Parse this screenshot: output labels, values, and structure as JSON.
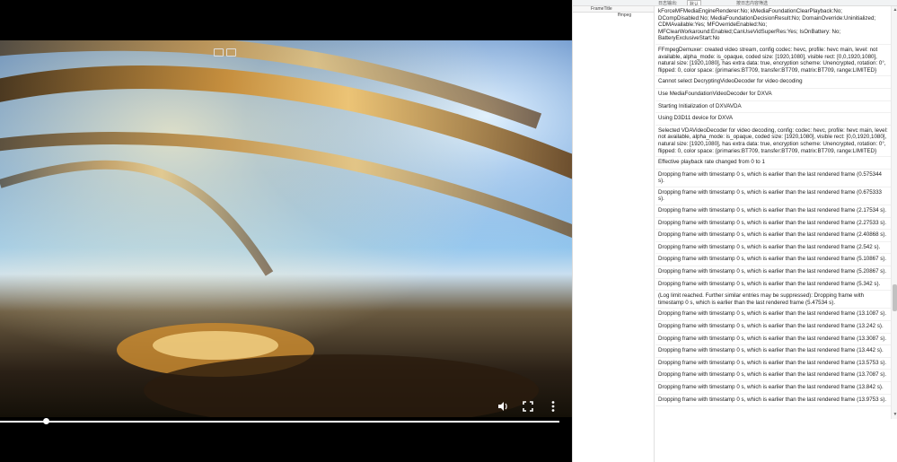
{
  "devtools": {
    "top_left_label": "日志输出:",
    "level_select": "默认",
    "filter_placeholder": "按日志内容筛选",
    "column_header": "FrameTitle",
    "column_header_2": "ffmpeg"
  },
  "log": [
    "kForceMFMediaEngineRenderer:No; kMediaFoundationClearPlayback:No; DCompDisabled:No; MediaFoundationDecisionResult:No; DomainOverride:Uninitialized; CDMAvailable:Yes; MFOverrideEnabled:No; MFClearWorkaround:Enabled;CanUseVidSuperRes:Yes; IsOnBattery: No; BatteryExclusiveStart:No",
    "FFmpegDemuxer: created video stream, config codec: hevc, profile: hevc main, level: not available, alpha_mode: is_opaque, coded size: [1920,1080], visible rect: [0,0,1920,1080], natural size: [1920,1080], has extra data: true, encryption scheme: Unencrypted, rotation: 0°, flipped: 0, color space: {primaries:BT709, transfer:BT709, matrix:BT709, range:LIMITED}",
    "Cannot select DecryptingVideoDecoder for video decoding",
    "Use MediaFoundationVideoDecoder for DXVA",
    "Starting Initialization of DXVAVDA",
    "Using D3D11 device for DXVA",
    "Selected VDAVideoDecoder for video decoding, config: codec: hevc, profile: hevc main, level: not available, alpha_mode: is_opaque, coded size: [1920,1080], visible rect: [0,0,1920,1080], natural size: [1920,1080], has extra data: true, encryption scheme: Unencrypted, rotation: 0°, flipped: 0, color space: {primaries:BT709, transfer:BT709, matrix:BT709, range:LIMITED}",
    "Effective playback rate changed from 0 to 1",
    "Dropping frame with timestamp 0 s, which is earlier than the last rendered frame (0.575344 s).",
    "Dropping frame with timestamp 0 s, which is earlier than the last rendered frame (0.675333 s).",
    "Dropping frame with timestamp 0 s, which is earlier than the last rendered frame (2.17534 s).",
    "Dropping frame with timestamp 0 s, which is earlier than the last rendered frame (2.27533 s).",
    "Dropping frame with timestamp 0 s, which is earlier than the last rendered frame (2.40868 s).",
    "Dropping frame with timestamp 0 s, which is earlier than the last rendered frame (2.542 s).",
    "Dropping frame with timestamp 0 s, which is earlier than the last rendered frame (5.10867 s).",
    "Dropping frame with timestamp 0 s, which is earlier than the last rendered frame (5.20867 s).",
    "Dropping frame with timestamp 0 s, which is earlier than the last rendered frame (5.342 s).",
    "(Log limit reached. Further similar entries may be suppressed): Dropping frame with timestamp 0 s, which is earlier than the last rendered frame (5.47534 s).",
    "Dropping frame with timestamp 0 s, which is earlier than the last rendered frame (13.1087 s).",
    "Dropping frame with timestamp 0 s, which is earlier than the last rendered frame (13.242 s).",
    "Dropping frame with timestamp 0 s, which is earlier than the last rendered frame (13.3087 s).",
    "Dropping frame with timestamp 0 s, which is earlier than the last rendered frame (13.442 s).",
    "Dropping frame with timestamp 0 s, which is earlier than the last rendered frame (13.5753 s).",
    "Dropping frame with timestamp 0 s, which is earlier than the last rendered frame (13.7087 s).",
    "Dropping frame with timestamp 0 s, which is earlier than the last rendered frame (13.842 s).",
    "Dropping frame with timestamp 0 s, which is earlier than the last rendered frame (13.9753 s)."
  ],
  "player": {
    "progress": 0.08,
    "icons": {
      "pip": "picture-in-picture-icon",
      "mute": "volume-icon",
      "fullscreen": "fullscreen-icon",
      "more": "more-vertical-icon"
    }
  }
}
